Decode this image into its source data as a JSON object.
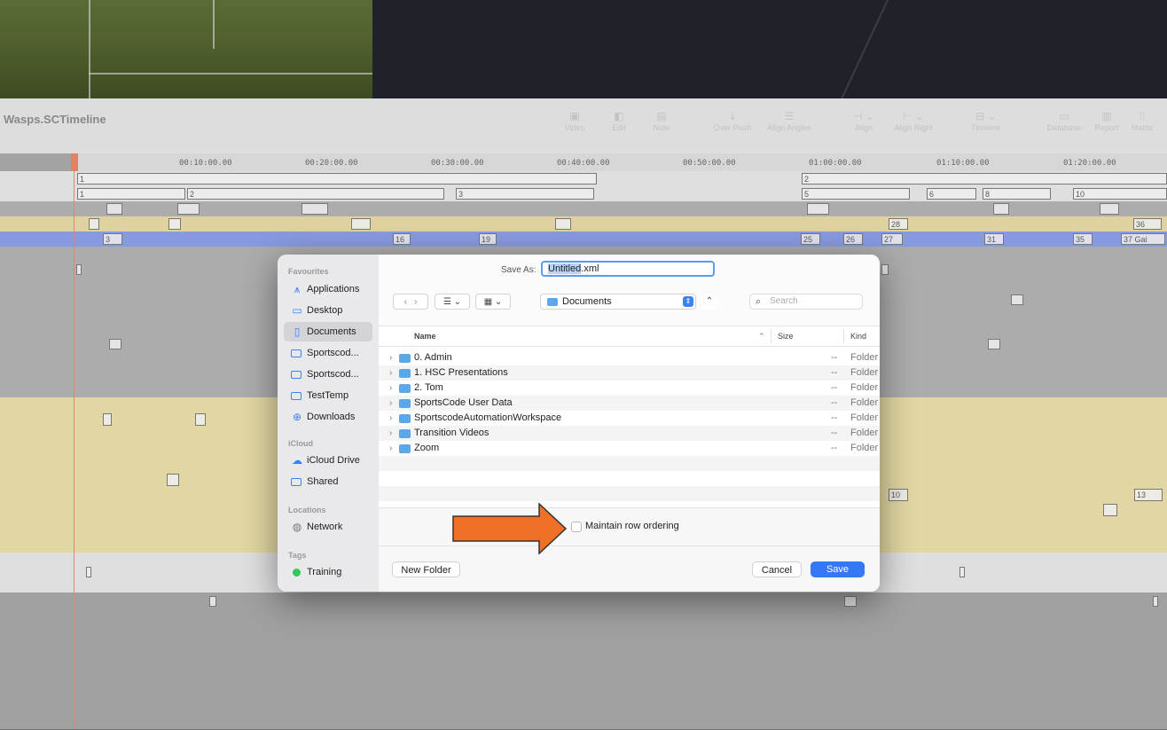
{
  "app": {
    "window_title": "Wasps.SCTimeline"
  },
  "toolbar": {
    "buttons": [
      {
        "label": "Video",
        "icon": "video-icon"
      },
      {
        "label": "Edit",
        "icon": "edit-icon"
      },
      {
        "label": "Note",
        "icon": "note-icon"
      },
      {
        "label": "Over Push",
        "icon": "push-icon"
      },
      {
        "label": "Align Angles",
        "icon": "align-angles-icon"
      },
      {
        "label": "Align",
        "icon": "align-icon"
      },
      {
        "label": "Align Right",
        "icon": "align-right-icon"
      },
      {
        "label": "Timeline",
        "icon": "timeline-icon"
      },
      {
        "label": "Database",
        "icon": "database-icon"
      },
      {
        "label": "Report",
        "icon": "report-icon"
      },
      {
        "label": "Matrix",
        "icon": "matrix-icon"
      }
    ]
  },
  "ruler": {
    "ticks": [
      "00:10:00.00",
      "00:20:00.00",
      "00:30:00.00",
      "00:40:00.00",
      "00:50:00.00",
      "01:00:00.00",
      "01:10:00.00",
      "01:20:00.00"
    ]
  },
  "timeline": {
    "row_labels": {
      "r1": [
        "1",
        "2"
      ],
      "r2": [
        "1",
        "2",
        "3",
        "5",
        "6",
        "8",
        "10"
      ],
      "r4": [
        "28",
        "36"
      ],
      "r5": [
        "3",
        "16",
        "19",
        "25",
        "26",
        "27",
        "31",
        "35",
        "37 Gai"
      ],
      "r_mid": [
        "10",
        "13"
      ]
    }
  },
  "dialog": {
    "save_as_label": "Save As:",
    "filename_highlight": "Untitled",
    "filename_rest": ".xml",
    "location": "Documents",
    "search_placeholder": "Search",
    "sidebar": {
      "favourites_header": "Favourites",
      "favourites": [
        {
          "label": "Applications",
          "icon": "applications-icon"
        },
        {
          "label": "Desktop",
          "icon": "desktop-icon"
        },
        {
          "label": "Documents",
          "icon": "document-icon",
          "selected": true
        },
        {
          "label": "Sportscod...",
          "icon": "folder-icon"
        },
        {
          "label": "Sportscod...",
          "icon": "folder-icon"
        },
        {
          "label": "TestTemp",
          "icon": "folder-icon"
        },
        {
          "label": "Downloads",
          "icon": "download-icon"
        }
      ],
      "icloud_header": "iCloud",
      "icloud": [
        {
          "label": "iCloud Drive",
          "icon": "cloud-icon"
        },
        {
          "label": "Shared",
          "icon": "shared-folder-icon"
        }
      ],
      "locations_header": "Locations",
      "locations": [
        {
          "label": "Network",
          "icon": "globe-icon"
        }
      ],
      "tags_header": "Tags",
      "tags": [
        {
          "label": "Training",
          "color": "#34c759"
        }
      ]
    },
    "columns": {
      "name": "Name",
      "size": "Size",
      "kind": "Kind"
    },
    "files": [
      {
        "name": "0. Admin",
        "size": "--",
        "kind": "Folder"
      },
      {
        "name": "1. HSC Presentations",
        "size": "--",
        "kind": "Folder"
      },
      {
        "name": "2. Tom",
        "size": "--",
        "kind": "Folder"
      },
      {
        "name": "SportsCode User Data",
        "size": "--",
        "kind": "Folder"
      },
      {
        "name": "SportscodeAutomationWorkspace",
        "size": "--",
        "kind": "Folder"
      },
      {
        "name": "Transition Videos",
        "size": "--",
        "kind": "Folder"
      },
      {
        "name": "Zoom",
        "size": "--",
        "kind": "Folder"
      }
    ],
    "maintain_row_ordering_label": "Maintain row ordering",
    "maintain_row_ordering_checked": false,
    "new_folder_label": "New Folder",
    "cancel_label": "Cancel",
    "save_label": "Save",
    "accent_color": "#3478f6"
  },
  "annotation": {
    "arrow_color": "#f07028"
  }
}
